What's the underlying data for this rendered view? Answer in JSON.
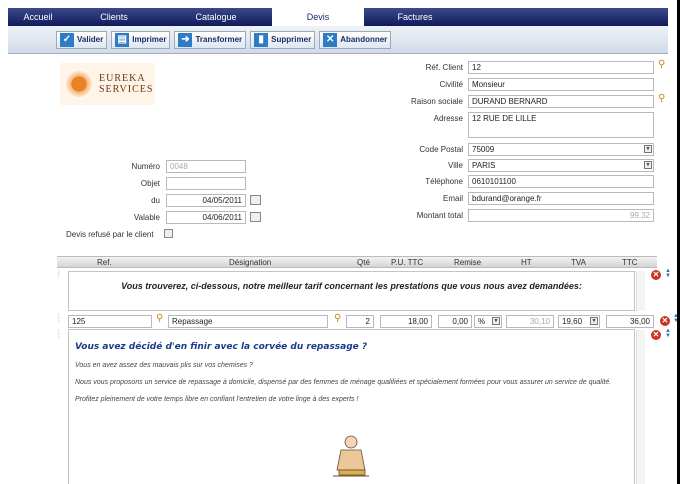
{
  "nav": {
    "tabs": [
      "Accueil",
      "Clients",
      "Catalogue",
      "Devis",
      "Factures"
    ],
    "active": "Devis"
  },
  "toolbar": {
    "valider": "Valider",
    "imprimer": "Imprimer",
    "transformer": "Transformer",
    "supprimer": "Supprimer",
    "abandonner": "Abandonner"
  },
  "logo": {
    "line1": "EUREKA",
    "line2": "SERVICES"
  },
  "devis": {
    "numero_label": "Numéro",
    "numero": "0048",
    "objet_label": "Objet",
    "objet": "",
    "du_label": "du",
    "du": "04/05/2011",
    "valable_label": "Valable",
    "valable": "04/06/2011",
    "refuse_label": "Devis refusé par le client"
  },
  "client": {
    "ref_label": "Réf. Client",
    "ref": "12",
    "civilite_label": "Civilité",
    "civilite": "Monsieur",
    "raison_label": "Raison sociale",
    "raison": "DURAND BERNARD",
    "adresse_label": "Adresse",
    "adresse": "12 RUE DE LILLE",
    "cp_label": "Code Postal",
    "cp": "75009",
    "ville_label": "Ville",
    "ville": "PARIS",
    "tel_label": "Téléphone",
    "tel": "0610101100",
    "email_label": "Email",
    "email": "bdurand@orange.fr",
    "montant_label": "Montant total",
    "montant": "99,32"
  },
  "table": {
    "headers": {
      "ref": "Ref.",
      "designation": "Désignation",
      "qte": "Qté",
      "pu": "P.U. TTC",
      "remise": "Remise",
      "ht": "HT",
      "tva": "TVA",
      "ttc": "TTC"
    },
    "intro_note": "Vous trouverez, ci-dessous, notre meilleur tarif concernant les prestations que vous nous avez demandées:",
    "line": {
      "ref": "125",
      "designation": "Repassage",
      "qte": "2",
      "pu": "18,00",
      "remise": "0,00",
      "remise_unit": "%",
      "ht": "30,10",
      "tva": "19,60",
      "ttc": "36,00"
    },
    "desc": {
      "title": "Vous avez décidé d'en finir avec la corvée du repassage ?",
      "p1": "Vous en avez assez des mauvais plis sur vos chemises ?",
      "p2": "Nous vous proposons un service de repassage à domicile, dispensé par des femmes de ménage qualifiées et spécialement formées pour vous assurer un service de qualité.",
      "p3": "Profitez pleinement de votre temps libre en confiant l'entretien de votre linge à des experts !"
    }
  },
  "icons": {
    "valider": "check-icon",
    "imprimer": "printer-icon",
    "transformer": "arrow-right-icon",
    "supprimer": "trash-icon",
    "abandonner": "close-icon",
    "search": "magnifier-icon",
    "calendar": "calendar-icon",
    "delete": "delete-icon",
    "reorder": "reorder-icon",
    "drag": "drag-handle-icon"
  },
  "colors": {
    "nav": "#1a2a6e",
    "accent": "#2e7bc6",
    "title_blue": "#1a3a8a",
    "delete_red": "#c8321e"
  }
}
